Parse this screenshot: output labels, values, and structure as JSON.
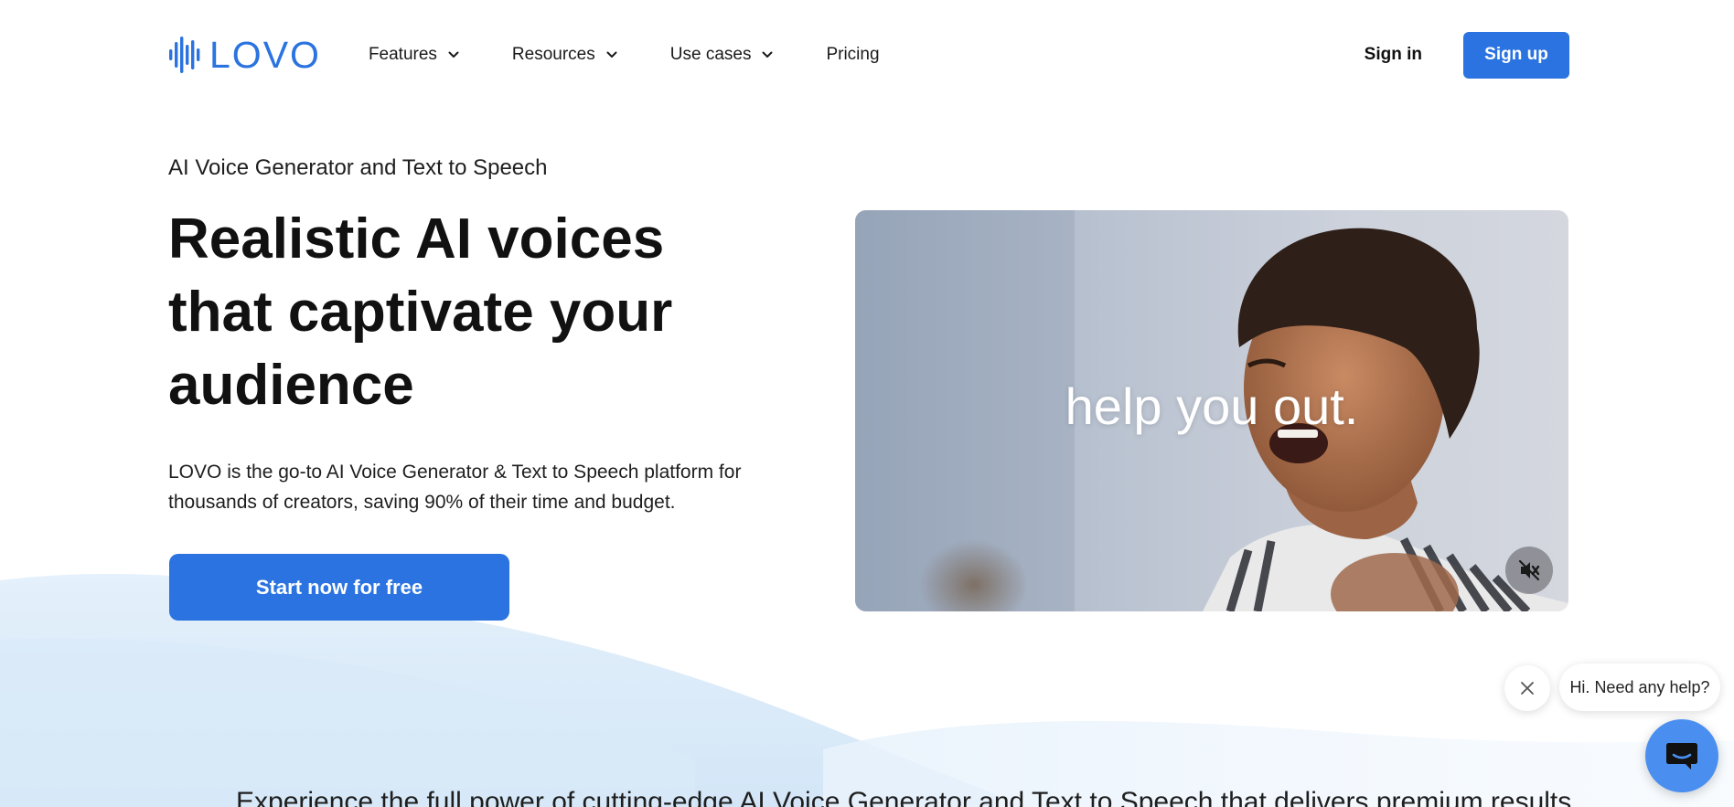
{
  "brand": {
    "name": "LOVO",
    "color": "#2a73e0"
  },
  "nav": {
    "items": [
      {
        "label": "Features",
        "has_dropdown": true
      },
      {
        "label": "Resources",
        "has_dropdown": true
      },
      {
        "label": "Use cases",
        "has_dropdown": true
      },
      {
        "label": "Pricing",
        "has_dropdown": false
      }
    ]
  },
  "auth": {
    "sign_in": "Sign in",
    "sign_up": "Sign up"
  },
  "hero": {
    "eyebrow": "AI Voice Generator and Text to Speech",
    "title": "Realistic AI voices that captivate your audience",
    "description": "LOVO is the go-to AI Voice Generator & Text to Speech platform for thousands of creators, saving 90% of their time and budget.",
    "cta": "Start now for free"
  },
  "video": {
    "caption": "help you out.",
    "mute_icon": "speaker-muted-icon"
  },
  "chat": {
    "greeting": "Hi. Need any help?",
    "close_icon": "close-icon",
    "launcher_icon": "chat-icon",
    "launcher_color": "#4a8ff0"
  },
  "section": {
    "intro": "Experience the full power of cutting-edge AI Voice Generator and Text to Speech that delivers premium results"
  }
}
